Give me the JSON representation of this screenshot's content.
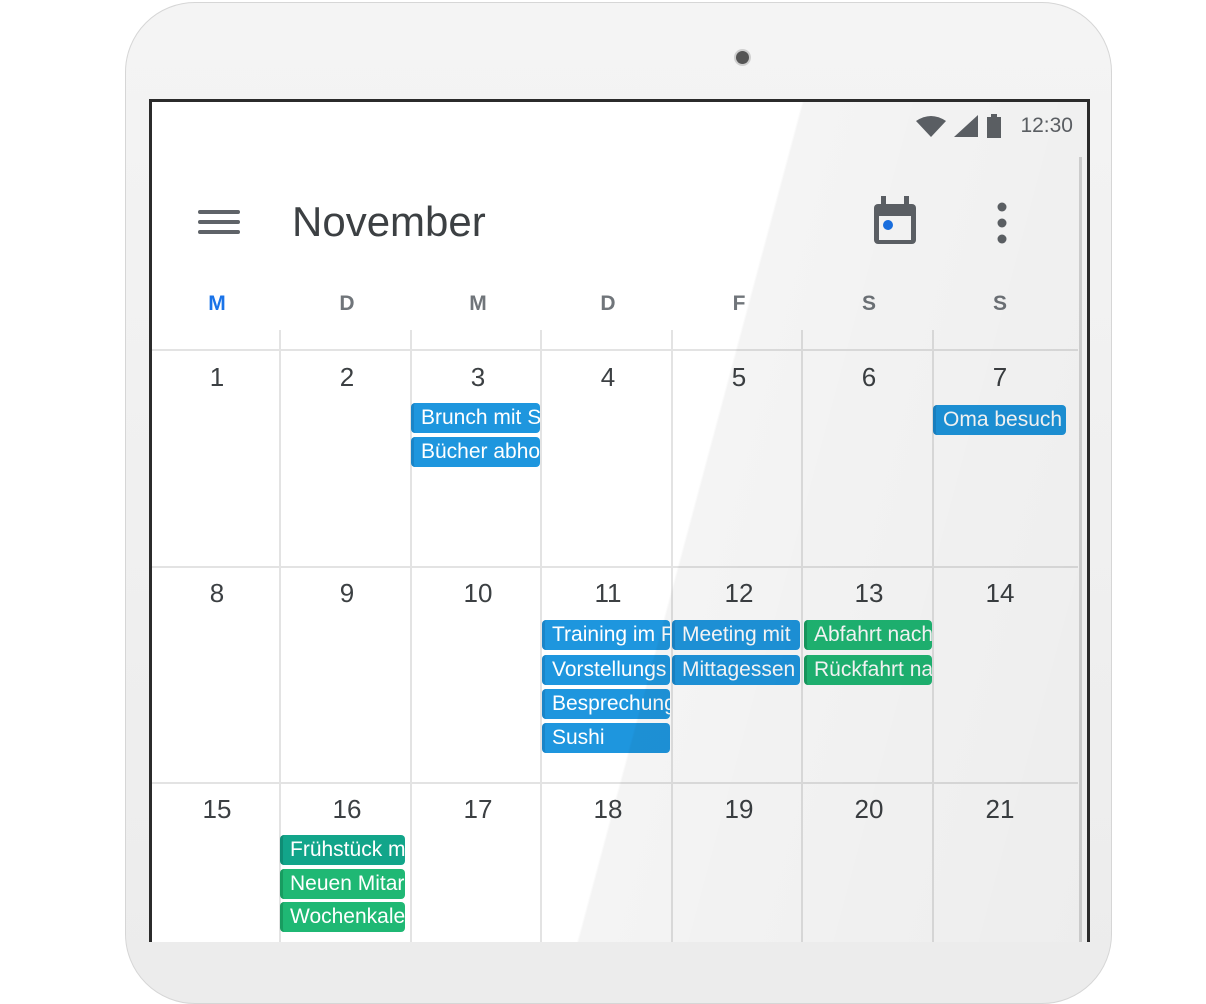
{
  "status_bar": {
    "time": "12:30",
    "icons": [
      "wifi-icon",
      "signal-icon",
      "battery-icon"
    ]
  },
  "app_bar": {
    "title": "November",
    "menu_icon": "menu-icon",
    "today_icon": "calendar-today-icon",
    "more_icon": "more-vert-icon"
  },
  "weekdays": [
    "M",
    "D",
    "M",
    "D",
    "F",
    "S",
    "S"
  ],
  "weeks": [
    {
      "days": [
        "1",
        "2",
        "3",
        "4",
        "5",
        "6",
        "7"
      ]
    },
    {
      "days": [
        "8",
        "9",
        "10",
        "11",
        "12",
        "13",
        "14"
      ]
    },
    {
      "days": [
        "15",
        "16",
        "17",
        "18",
        "19",
        "20",
        "21"
      ]
    }
  ],
  "events": [
    {
      "label": "Brunch mit S",
      "color": "blue"
    },
    {
      "label": "Bücher abho",
      "color": "blue"
    },
    {
      "label": "Oma besuch",
      "color": "blue"
    },
    {
      "label": "Training im F",
      "color": "blue"
    },
    {
      "label": "Vorstellungs",
      "color": "blue"
    },
    {
      "label": "Besprechung",
      "color": "blue"
    },
    {
      "label": "Sushi",
      "color": "blue"
    },
    {
      "label": "Meeting mit",
      "color": "blue"
    },
    {
      "label": "Mittagessen",
      "color": "blue"
    },
    {
      "label": "Abfahrt nach",
      "color": "green"
    },
    {
      "label": "Rückfahrt na",
      "color": "green"
    },
    {
      "label": "Frühstück m",
      "color": "teal"
    },
    {
      "label": "Neuen Mitar",
      "color": "green"
    },
    {
      "label": "Wochenkale",
      "color": "green"
    }
  ],
  "colors": {
    "today": "#1a73e8",
    "blue": "#1e96de",
    "green": "#1fb874",
    "teal": "#12a58a",
    "text": "#3c4043"
  }
}
